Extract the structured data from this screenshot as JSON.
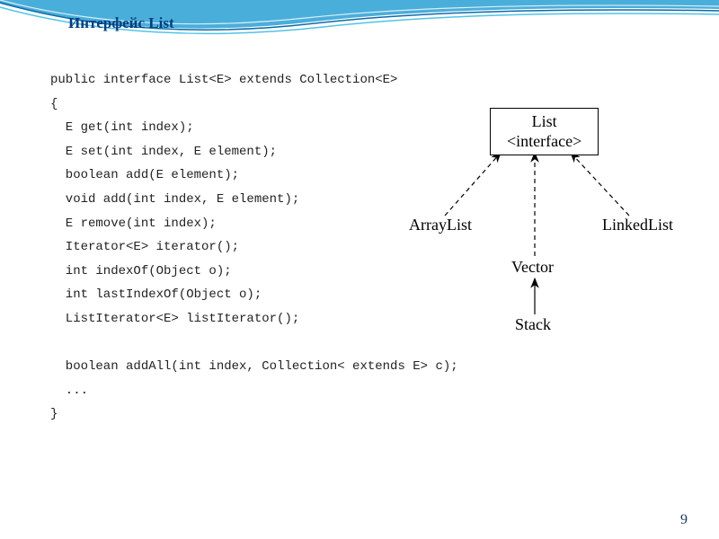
{
  "slide": {
    "title": "Интерфейс List",
    "pageNumber": "9"
  },
  "code": {
    "l1": "public interface List<E> extends Collection<E>",
    "l2": "{",
    "l3": "  E get(int index);",
    "l4": "  E set(int index, E element);",
    "l5": "  boolean add(E element);",
    "l6": "  void add(int index, E element);",
    "l7": "  E remove(int index);",
    "l8": "  Iterator<E> iterator();",
    "l9": "  int indexOf(Object o);",
    "l10": "  int lastIndexOf(Object o);",
    "l11": "  ListIterator<E> listIterator();",
    "l12": "",
    "l13": "  boolean addAll(int index, Collection< extends E> c);",
    "l14": "  ...",
    "l15": "}"
  },
  "diagram": {
    "listBox": {
      "line1": "List",
      "line2": "<interface>"
    },
    "arrayList": "ArrayList",
    "linkedList": "LinkedList",
    "vector": "Vector",
    "stack": "Stack"
  }
}
